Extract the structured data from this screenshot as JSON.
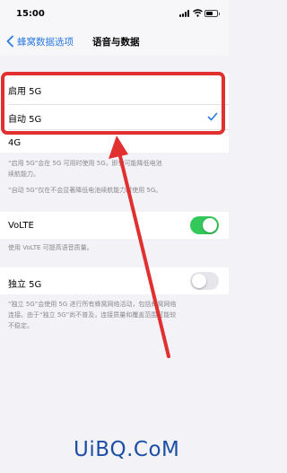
{
  "status_bar": {
    "time": "15:00"
  },
  "nav": {
    "back_label": "蜂窝数据选项",
    "title": "语音与数据"
  },
  "options": [
    {
      "label": "启用 5G",
      "selected": false
    },
    {
      "label": "自动 5G",
      "selected": true
    },
    {
      "label": "4G",
      "selected": false
    }
  ],
  "notes": {
    "enable5g": [
      "“启用 5G”会在 5G 可用时使用 5G，即使可能降低电池",
      "续航能力。"
    ],
    "auto5g": "“自动 5G”仅在不会显著降低电池续航能力时使用 5G。",
    "volte": "使用 VoLTE 可提高语音质量。",
    "standalone": [
      "“独立 5G”会使用 5G 进行所有蜂窝网络活动，包括蜂窝网络",
      "连接。由于“独立 5G”尚不普及，连接质量和覆盖范围可能较",
      "不稳定。"
    ]
  },
  "volte": {
    "label": "VoLTE",
    "enabled": true
  },
  "standalone_5g": {
    "label": "独立 5G",
    "enabled": false
  },
  "colors": {
    "accent": "#2a7ae4",
    "toggle_on": "#34c759",
    "highlight": "#e0302f"
  },
  "watermark": "UiBQ.CoM"
}
